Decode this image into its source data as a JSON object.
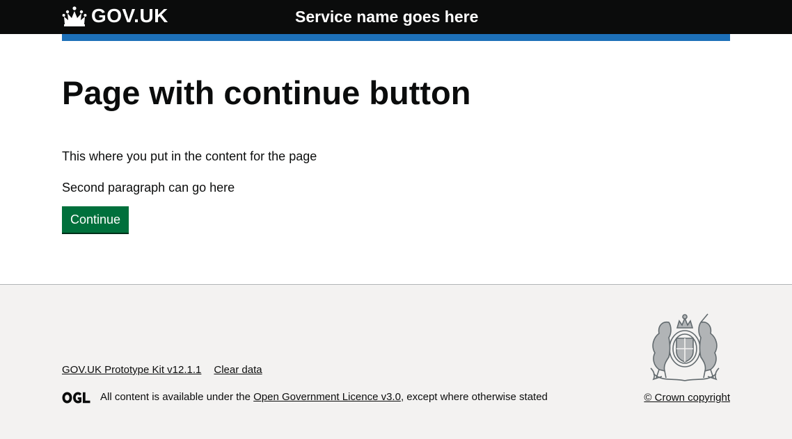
{
  "header": {
    "logo_text": "GOV.UK",
    "service_name": "Service name goes here"
  },
  "main": {
    "title": "Page with continue button",
    "paragraphs": [
      "This where you put in the content for the page",
      "Second paragraph can go here"
    ],
    "continue_label": "Continue"
  },
  "footer": {
    "links": [
      "GOV.UK Prototype Kit v12.1.1",
      "Clear data"
    ],
    "licence_prefix": "All content is available under the ",
    "licence_link": "Open Government Licence v3.0",
    "licence_suffix": ", except where otherwise stated",
    "copyright": "© Crown copyright"
  },
  "icons": {
    "header_logo": "crown-icon",
    "licence_logo": "ogl-icon",
    "crest": "royal-coat-of-arms-icon"
  },
  "colors": {
    "header_bg": "#0b0c0c",
    "blue_bar": "#1d70b8",
    "button_bg": "#00703c",
    "footer_bg": "#f3f2f1"
  }
}
